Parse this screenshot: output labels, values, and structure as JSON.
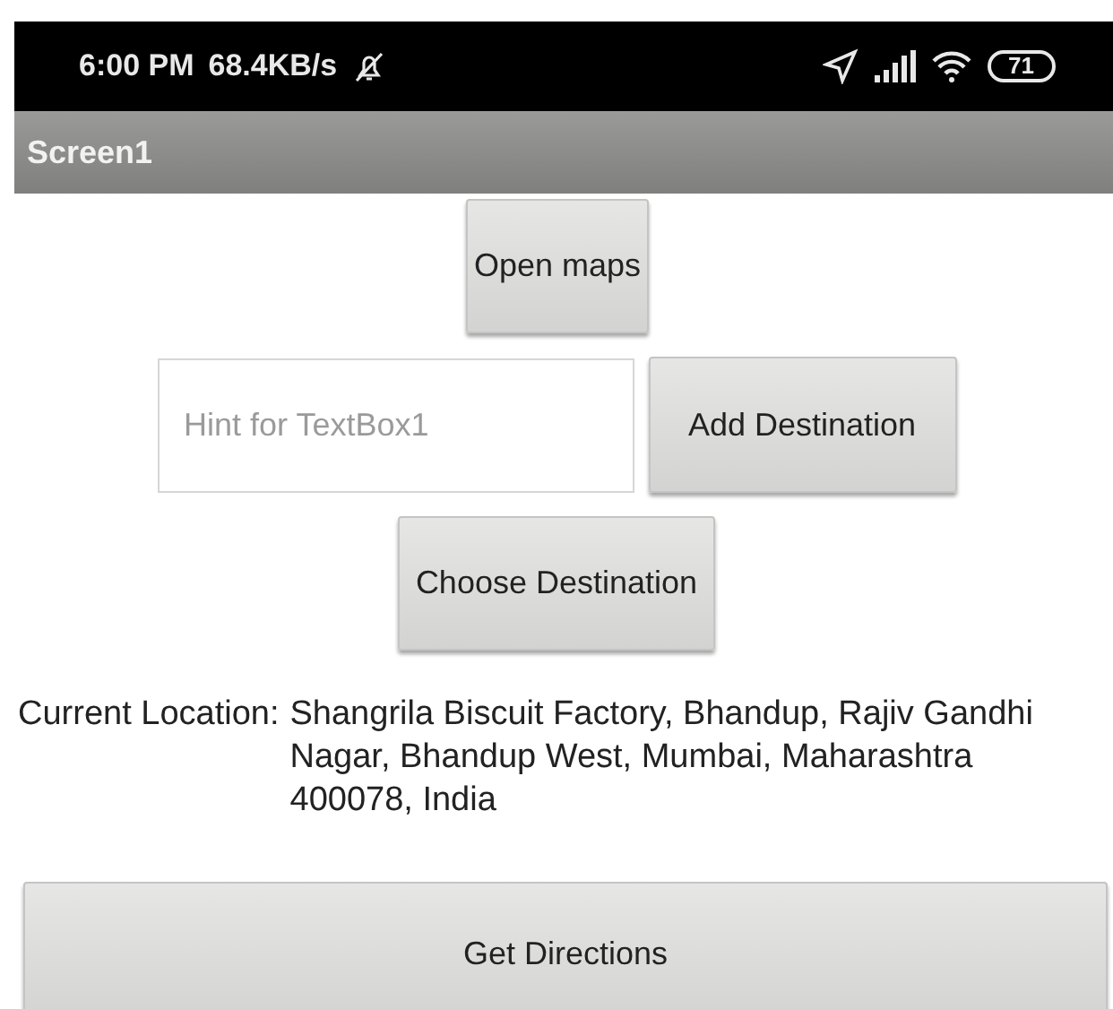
{
  "status_bar": {
    "time": "6:00 PM",
    "speed": "68.4KB/s",
    "battery": "71"
  },
  "title_bar": {
    "title": "Screen1"
  },
  "buttons": [
    {
      "label": "Open maps"
    }
  ],
  "destination_row": {
    "text_box": {
      "placeholder": "Hint for TextBox1"
    },
    "button": {
      "label": "Add Destination"
    }
  },
  "choose_button": {
    "label": "Choose Destination"
  },
  "current_location": {
    "label": "Current Location:",
    "value": "Shangrila Biscuit Factory, Bhandup, Rajiv Gandhi Nagar, Bhandup West, Mumbai, Maharashtra 400078, India"
  },
  "get_directions": {
    "label": "Get Directions"
  }
}
